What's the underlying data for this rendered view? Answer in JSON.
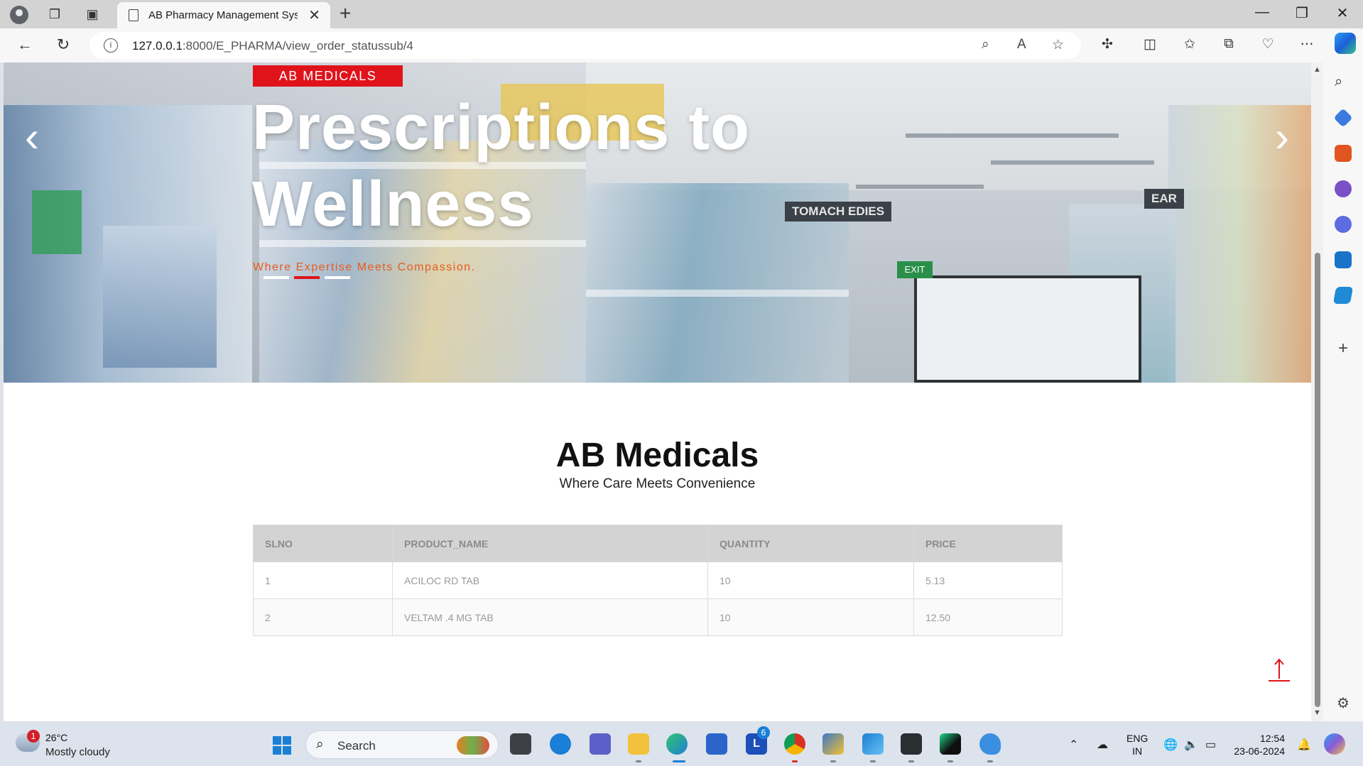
{
  "browser": {
    "tab_title": "AB Pharmacy Management Syste",
    "url_host": "127.0.0.1",
    "url_path": ":8000/E_PHARMA/view_order_statussub/4"
  },
  "hero": {
    "badge": "AB MEDICALS",
    "title": "Prescriptions to Wellness",
    "subtitle": "Where Expertise Meets Compassion.",
    "signs": [
      "TOMACH EDIES",
      "EAR"
    ],
    "exit_sign": "EXIT"
  },
  "main": {
    "brand": "AB Medicals",
    "tagline": "Where Care Meets Convenience"
  },
  "table": {
    "headers": [
      "SLNO",
      "PRODUCT_NAME",
      "QUANTITY",
      "PRICE"
    ],
    "rows": [
      [
        "1",
        "ACILOC RD TAB",
        "10",
        "5.13"
      ],
      [
        "2",
        "VELTAM .4 MG TAB",
        "10",
        "12.50"
      ]
    ]
  },
  "taskbar": {
    "weather_badge": "1",
    "temperature": "26°C",
    "condition": "Mostly cloudy",
    "search_placeholder": "Search",
    "lang_line1": "ENG",
    "lang_line2": "IN",
    "time": "12:54",
    "date": "23-06-2024",
    "teams_badge": "6"
  },
  "colors": {
    "accent_red": "#e0131b",
    "subtitle_orange": "#e85a1c"
  }
}
